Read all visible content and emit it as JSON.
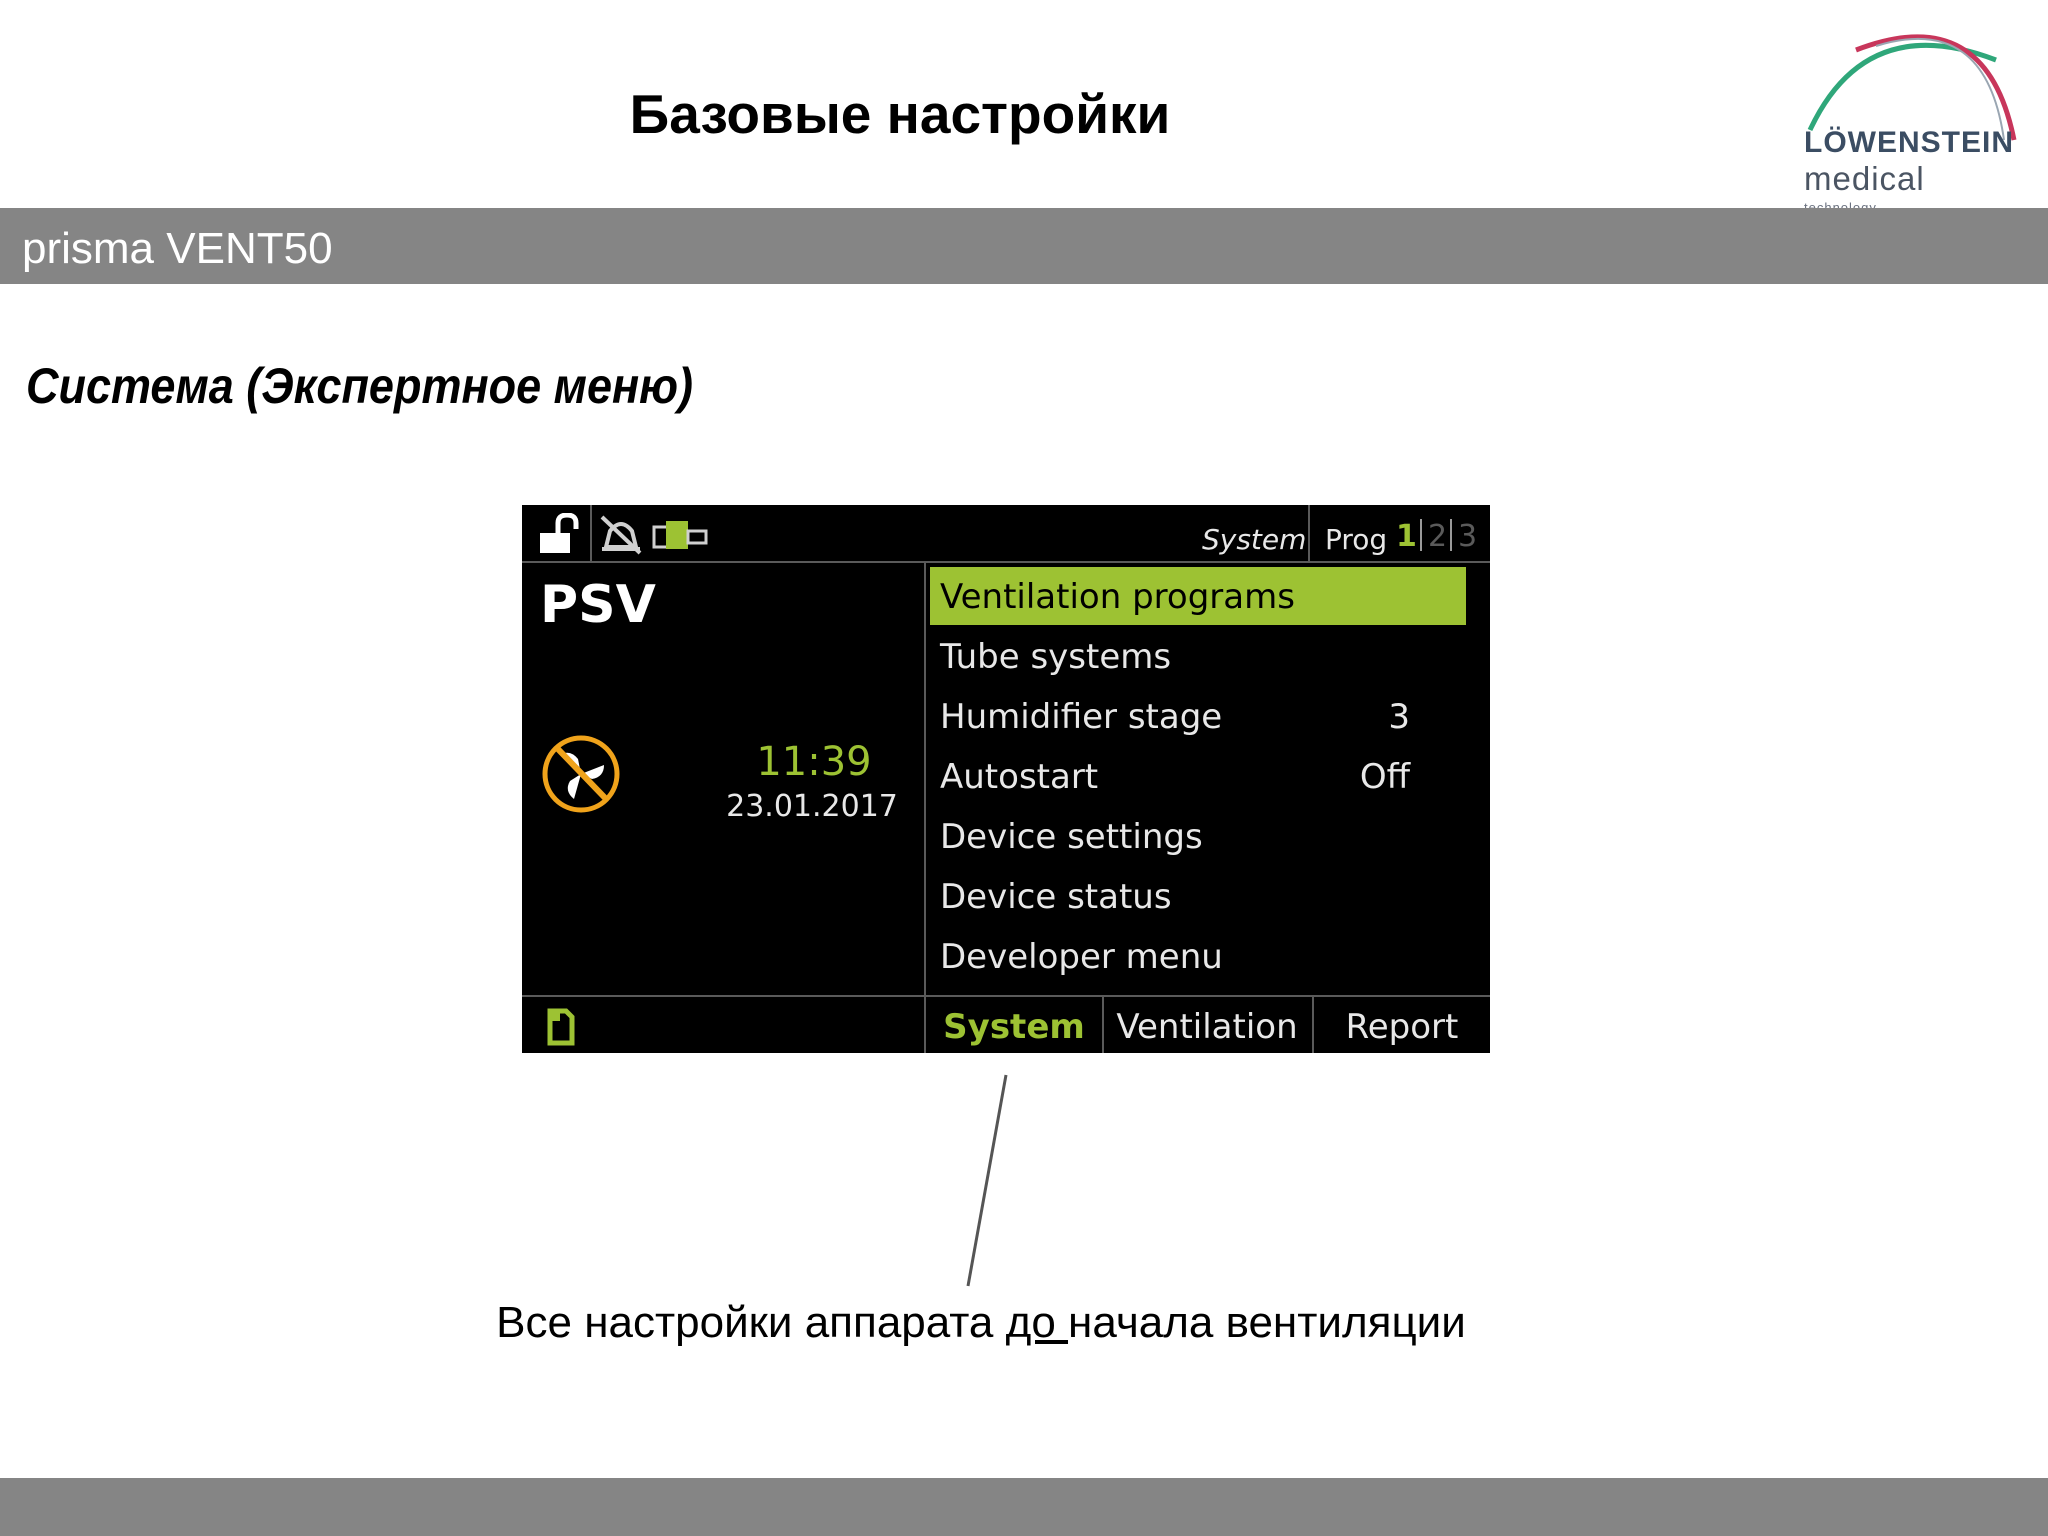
{
  "slide": {
    "title": "Базовые настройки",
    "product": "prisma VENT50",
    "section_heading": "Система (Экспертное меню)",
    "caption_before": "Все настройки аппарата ",
    "caption_underlined": "до ",
    "caption_after": "начала вентиляции"
  },
  "logo": {
    "word": "LÖWENSTEIN",
    "sub": "medical",
    "tiny": "technology",
    "colors": {
      "green": "#2fa77a",
      "red": "#c8365b",
      "text": "#3b4d63"
    }
  },
  "device": {
    "top_bar": {
      "icons": [
        "unlock-icon",
        "alarm-muted-icon",
        "device-link-icon"
      ],
      "menu_context": "System",
      "prog_label": "Prog",
      "programs": [
        {
          "number": "1",
          "active": true
        },
        {
          "number": "2",
          "active": false
        },
        {
          "number": "3",
          "active": false
        }
      ]
    },
    "mode": "PSV",
    "status_icon": "ventilation-stopped-fan-icon",
    "time": "11:39",
    "date": "23.01.2017",
    "menu_items": [
      {
        "label": "Ventilation programs",
        "value": "",
        "selected": true
      },
      {
        "label": "Tube systems",
        "value": "",
        "selected": false
      },
      {
        "label": "Humidifier stage",
        "value": "3",
        "selected": false
      },
      {
        "label": "Autostart",
        "value": "Off",
        "selected": false
      },
      {
        "label": "Device settings",
        "value": "",
        "selected": false
      },
      {
        "label": "Device status",
        "value": "",
        "selected": false
      },
      {
        "label": "Developer menu",
        "value": "",
        "selected": false
      }
    ],
    "bottom_tabs": [
      {
        "label": "System",
        "active": true
      },
      {
        "label": "Ventilation",
        "active": false
      },
      {
        "label": "Report",
        "active": false
      }
    ],
    "colors": {
      "accent": "#9dc233",
      "background": "#000000",
      "text": "#e8e8e8",
      "warning": "#f0a31b"
    }
  }
}
